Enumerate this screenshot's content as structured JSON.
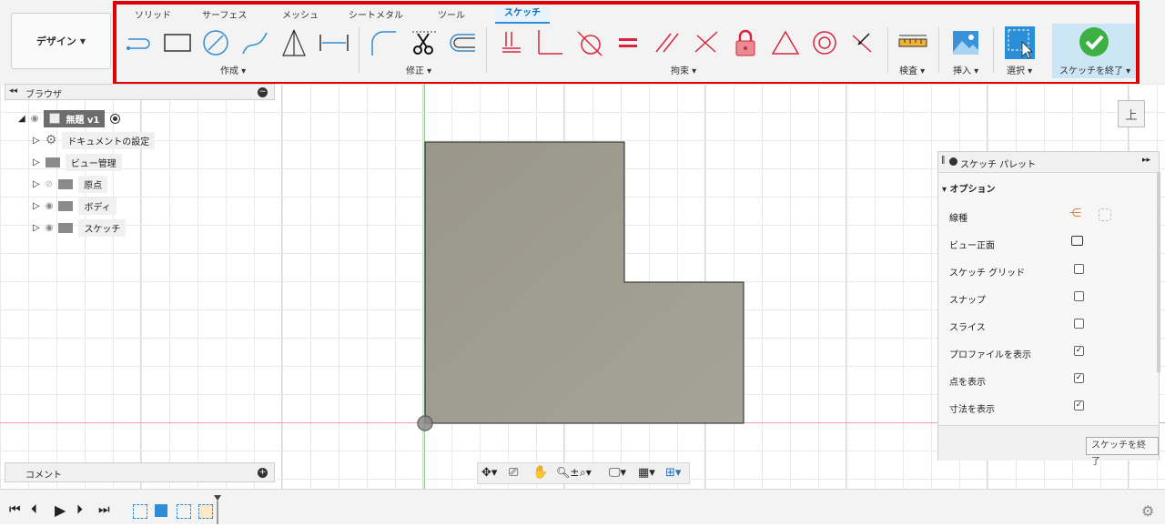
{
  "toolbar": {
    "design_label": "デザイン",
    "tabs": [
      {
        "label": "ソリッド"
      },
      {
        "label": "サーフェス"
      },
      {
        "label": "メッシュ"
      },
      {
        "label": "シートメタル"
      },
      {
        "label": "ツール"
      },
      {
        "label": "スケッチ",
        "active": true
      }
    ],
    "groups": {
      "create": "作成",
      "modify": "修正",
      "constraints": "拘束",
      "inspect": "検査",
      "insert": "挿入",
      "select": "選択",
      "finish": "スケッチを終了"
    },
    "colors": {
      "accent": "#2d8dd6",
      "highlight": "#e00000",
      "constraint_red": "#d7263d",
      "finish_green": "#3cb043"
    }
  },
  "browser": {
    "title": "ブラウザ",
    "root_label": "無題 v1",
    "items": [
      {
        "label": "ドキュメントの設定",
        "icon": "gear-icon"
      },
      {
        "label": "ビュー管理",
        "icon": "folder-icon"
      },
      {
        "label": "原点",
        "icon": "folder-icon",
        "hidden": true
      },
      {
        "label": "ボディ",
        "icon": "folder-icon"
      },
      {
        "label": "スケッチ",
        "icon": "folder-icon"
      }
    ]
  },
  "viewcube": {
    "label": "上"
  },
  "palette": {
    "title": "スケッチ パレット",
    "section": "オプション",
    "rows": [
      {
        "label": "線種",
        "type": "icons"
      },
      {
        "label": "ビュー正面",
        "type": "icon"
      },
      {
        "label": "スケッチ グリッド",
        "checked": false
      },
      {
        "label": "スナップ",
        "checked": false
      },
      {
        "label": "スライス",
        "checked": false
      },
      {
        "label": "プロファイルを表示",
        "checked": true
      },
      {
        "label": "点を表示",
        "checked": true
      },
      {
        "label": "寸法を表示",
        "checked": true
      }
    ],
    "finish_button": "スケッチを終了"
  },
  "comments": {
    "title": "コメント"
  },
  "sketch": {
    "fill_color": "#9c9a8e"
  }
}
